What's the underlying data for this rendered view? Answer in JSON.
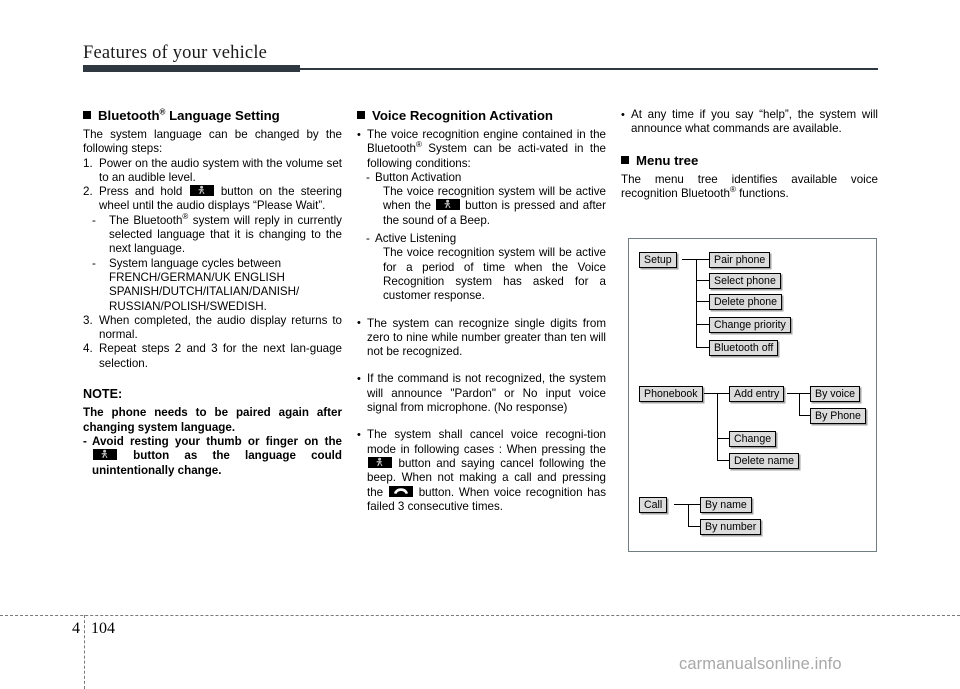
{
  "header": {
    "title": "Features of your vehicle"
  },
  "footer": {
    "chapter": "4",
    "page": "104",
    "watermark": "carmanualsonline.info"
  },
  "left_column": {
    "heading": "Bluetooth",
    "heading_sup": "®",
    "heading_rest": " Language Setting",
    "intro": "The system language can be changed by the following steps:",
    "step1_mark": "1.",
    "step1": "Power on the audio system with the volume set to an audible level.",
    "step2_mark": "2.",
    "step2_a": "Press and hold",
    "step2_icon": "steering-wheel-talk-button-icon",
    "step2_b": "button on the steering wheel until the audio displays “Please Wait”.",
    "sub1_mark": "-",
    "sub1_a": "The Bluetooth",
    "sub1_sup": "®",
    "sub1_b": " system will reply in currently selected language that it is changing to the next language.",
    "sub2_mark": "-",
    "sub2": "System language cycles between",
    "sub2_langs_1": "FRENCH/GERMAN/UK    ENGLISH",
    "sub2_langs_2": "SPANISH/DUTCH/ITALIAN/DANISH/",
    "sub2_langs_3": "RUSSIAN/POLISH/SWEDISH.",
    "step3_mark": "3.",
    "step3": "When completed, the audio display returns to normal.",
    "step4_mark": "4.",
    "step4": "Repeat steps 2 and 3 for the next lan-guage selection.",
    "note_title": "NOTE:",
    "note_body": "The phone needs to be paired again after changing system language.",
    "note_dash_mark": "-",
    "note_dash_a": "Avoid resting your thumb or finger on the",
    "note_dash_icon": "steering-wheel-talk-button-icon",
    "note_dash_b": "button as the language could unintentionally change."
  },
  "middle_column": {
    "heading": "Voice Recognition Activation",
    "b1_mark": "•",
    "b1_a": "The voice recognition engine contained in the Bluetooth",
    "b1_sup": "®",
    "b1_b": " System can be acti-vated in the following conditions:",
    "s1_mark": "-",
    "s1": "Button Activation",
    "s1_body_a": "The voice recognition system will be active when the",
    "s1_icon": "steering-wheel-talk-button-icon",
    "s1_body_b": "button is pressed and after the sound of a Beep.",
    "s2_mark": "-",
    "s2": "Active Listening",
    "s2_body": "The voice recognition system will be active for a period of time when the Voice Recognition system has asked for a customer response.",
    "b2_mark": "•",
    "b2": "The system can recognize single digits from zero to nine while number greater than ten will not be recognized.",
    "b3_mark": "•",
    "b3": "If the command is not recognized, the system will announce \"Pardon\" or No input voice signal from microphone. (No response)",
    "b4_mark": "•",
    "b4_a": "The system shall cancel voice recogni-tion mode in following cases : When pressing the",
    "b4_icon1": "steering-wheel-talk-button-icon",
    "b4_b": "button and saying cancel following the beep. When not making a call and pressing the",
    "b4_icon2": "end-call-handset-button-icon",
    "b4_c": "button. When voice recognition has failed 3 consecutive times."
  },
  "right_column": {
    "b1_mark": "•",
    "b1": "At any time if you say “help”, the system will announce what commands are available.",
    "heading": "Menu tree",
    "intro_a": "The menu tree identifies available voice recognition Bluetooth",
    "intro_sup": "®",
    "intro_b": " functions."
  },
  "menu_tree": {
    "groups": [
      {
        "root": "Setup",
        "children": [
          "Pair phone",
          "Select phone",
          "Delete phone",
          "Change priority",
          "Bluetooth off"
        ]
      },
      {
        "root": "Phonebook",
        "children": [
          "Add entry",
          "Change",
          "Delete name"
        ],
        "grandchildren": [
          "By voice",
          "By Phone"
        ]
      },
      {
        "root": "Call",
        "children": [
          "By name",
          "By number"
        ]
      }
    ],
    "nodes": {
      "setup": "Setup",
      "pair_phone": "Pair phone",
      "select_phone": "Select phone",
      "delete_phone": "Delete phone",
      "change_priority": "Change priority",
      "bluetooth_off": "Bluetooth off",
      "phonebook": "Phonebook",
      "add_entry": "Add entry",
      "by_voice": "By voice",
      "by_phone": "By Phone",
      "change": "Change",
      "delete_name": "Delete name",
      "call": "Call",
      "by_name": "By name",
      "by_number": "By number"
    }
  },
  "colors": {
    "rule": "#2f3740",
    "node_fill": "#dcdcdc",
    "box_border": "#6f7f84",
    "watermark": "#a8a8a8"
  }
}
